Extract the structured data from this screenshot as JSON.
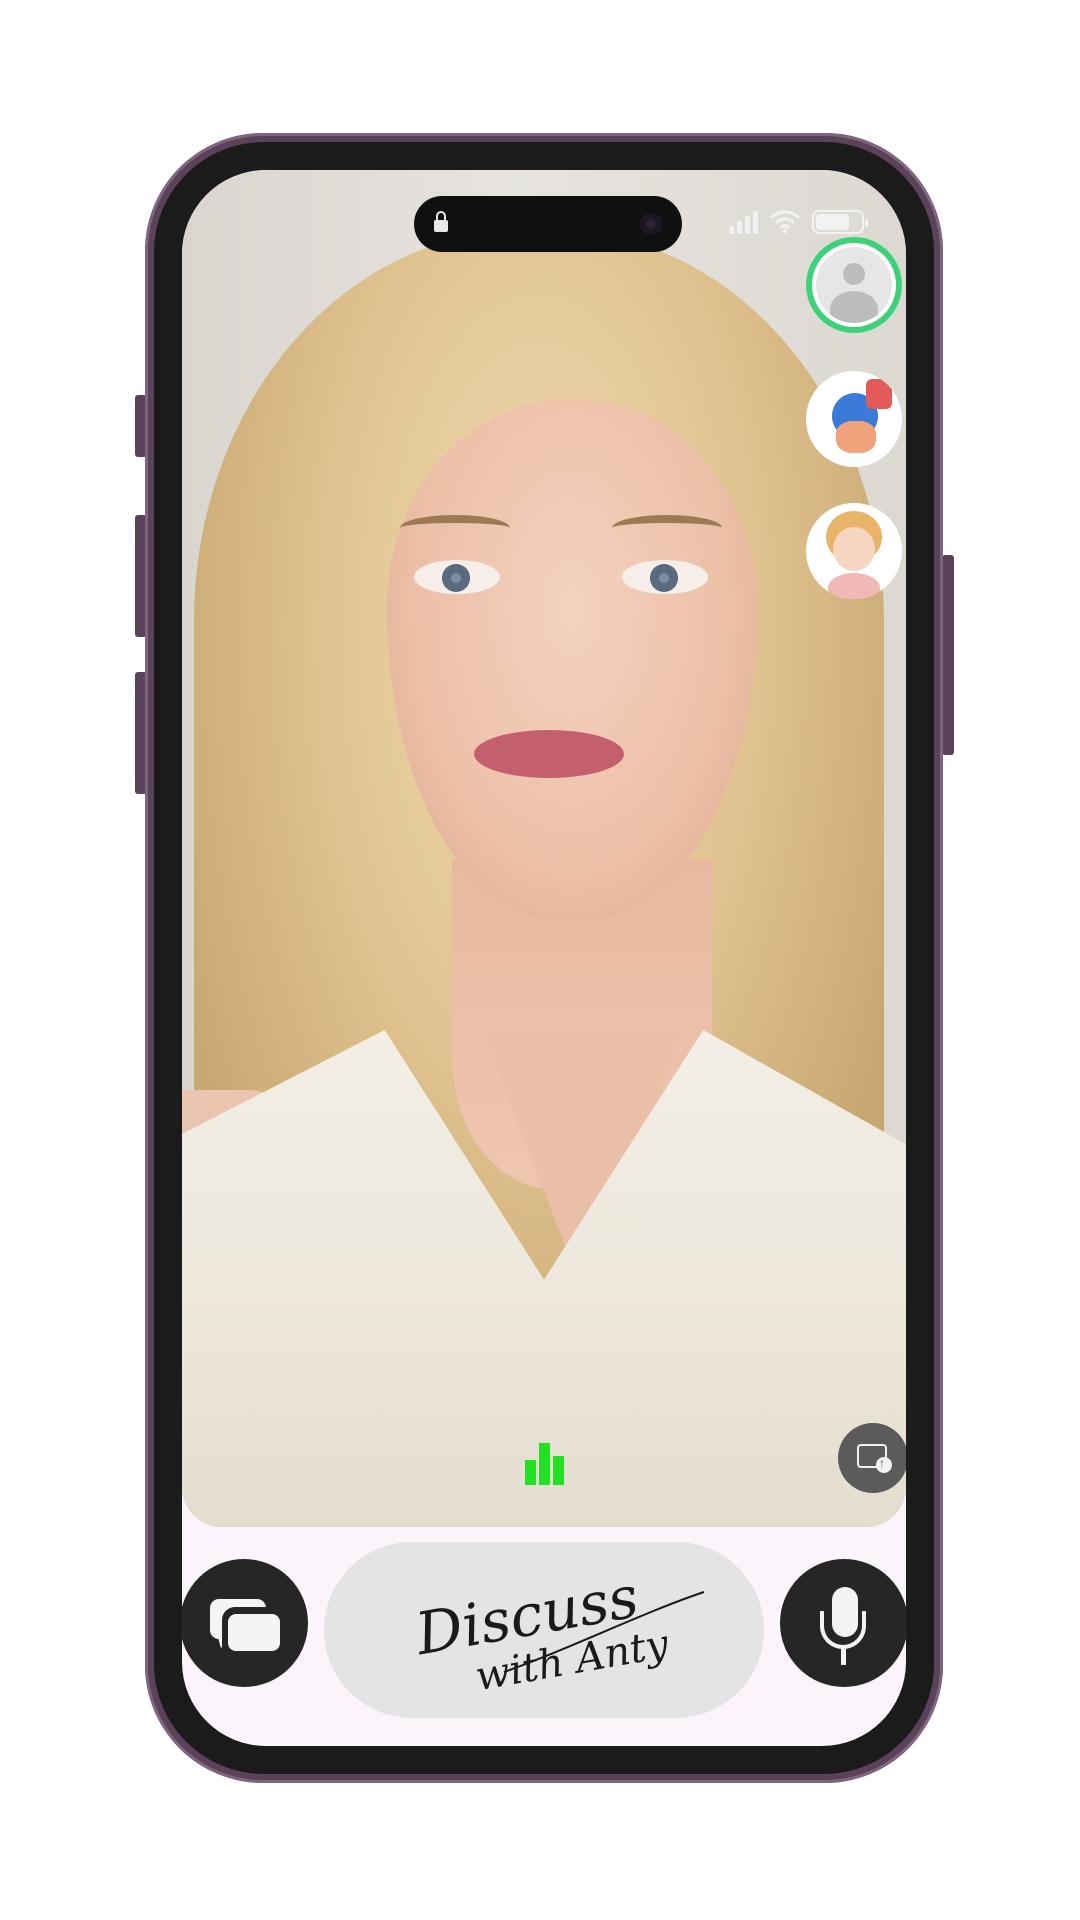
{
  "status_bar": {
    "lock_icon": "lock-icon",
    "signal_bars": 4,
    "battery_level": 0.75
  },
  "side_avatars": [
    {
      "name": "user-profile",
      "icon": "user-icon",
      "ring_color": "#3dd17a"
    },
    {
      "name": "megaphone-alert",
      "icon": "megaphone-icon"
    },
    {
      "name": "assistant-girl",
      "icon": "girl-avatar-icon"
    }
  ],
  "voice_level_bars": [
    0.6,
    1.0,
    0.7
  ],
  "voice_indicator_color": "#22e022",
  "upload_button": {
    "icon": "image-upload-icon"
  },
  "bottom_bar": {
    "chat_button": {
      "icon": "chat-bubbles-icon"
    },
    "discuss_logo": {
      "line1": "Discuss",
      "line2": "with Anty"
    },
    "mic_button": {
      "icon": "microphone-icon"
    }
  },
  "colors": {
    "phone_frame": "#5a4259",
    "screen_bg": "#fbf4fa",
    "button_dark": "#262626",
    "pill_bg": "#e4e3e6"
  }
}
